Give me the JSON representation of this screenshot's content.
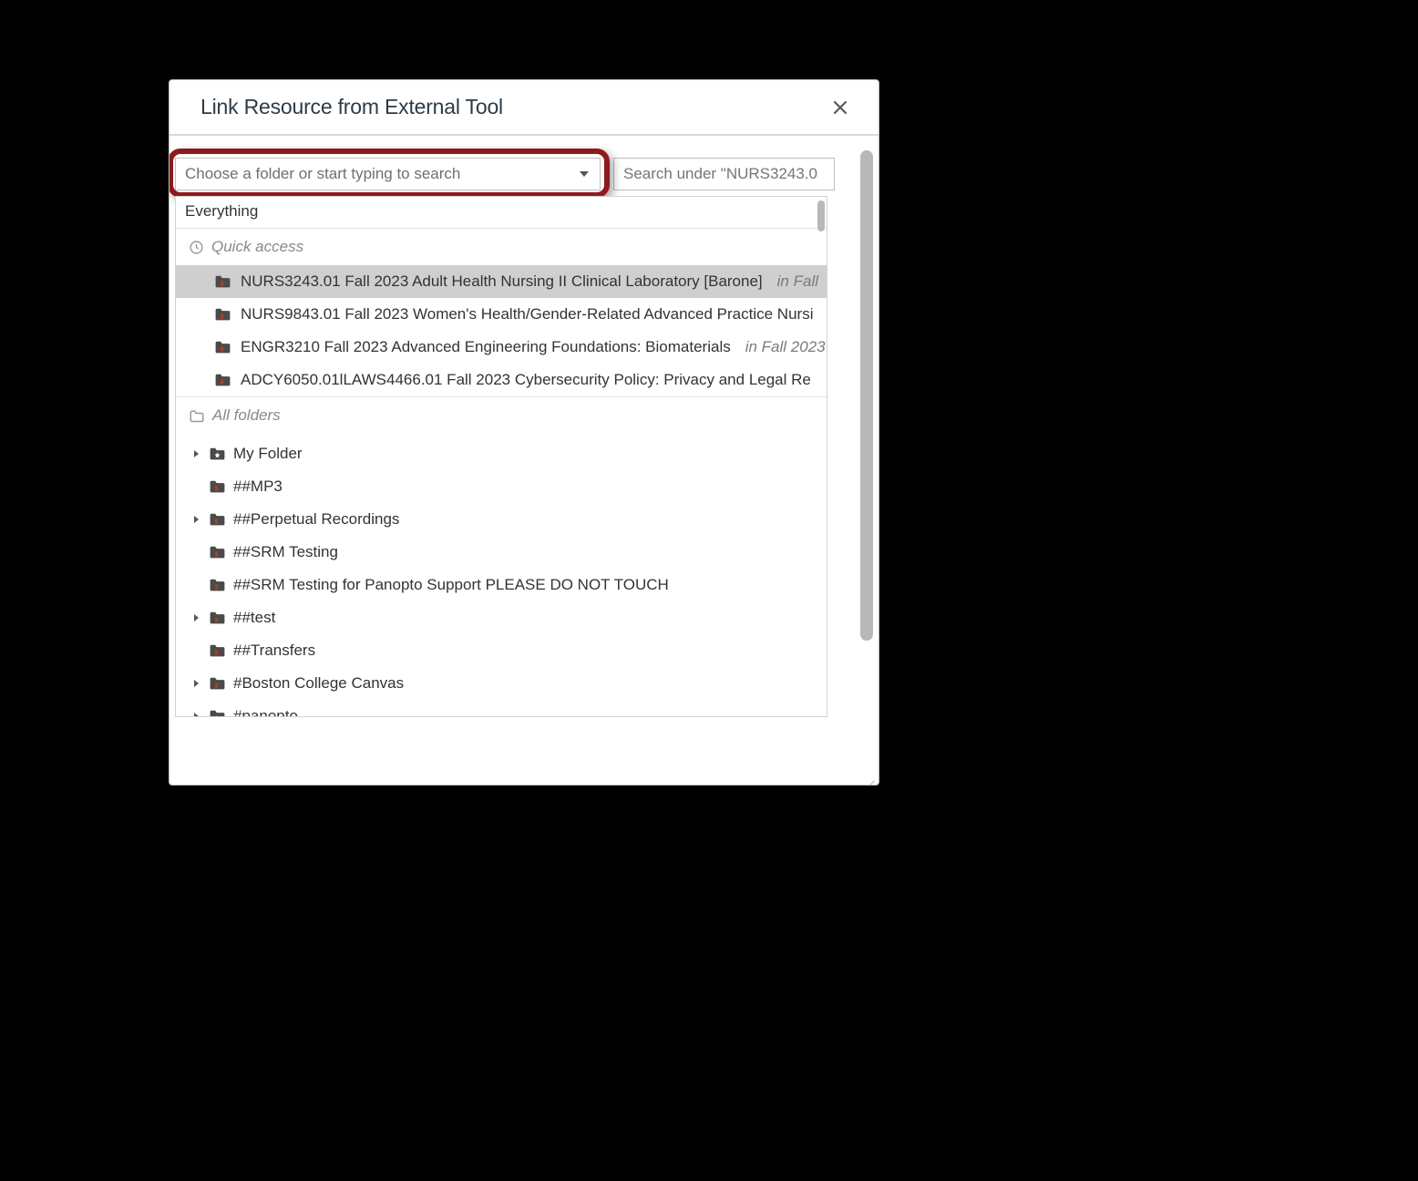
{
  "modal": {
    "title": "Link Resource from External Tool",
    "close_label": "Close"
  },
  "folder_select": {
    "placeholder": "Choose a folder or start typing to search"
  },
  "search": {
    "placeholder": "Search under \"NURS3243.0"
  },
  "dropdown": {
    "everything_label": "Everything",
    "quick_access_label": "Quick access",
    "quick_access_items": [
      {
        "label": "NURS3243.01 Fall 2023 Adult Health Nursing II Clinical Laboratory [Barone]",
        "suffix": "in Fall",
        "selected": true
      },
      {
        "label": "NURS9843.01 Fall 2023 Women's Health/Gender-Related Advanced Practice Nursi",
        "suffix": "",
        "selected": false
      },
      {
        "label": "ENGR3210 Fall 2023 Advanced Engineering Foundations: Biomaterials",
        "suffix": "in Fall 2023",
        "selected": false
      },
      {
        "label": "ADCY6050.01lLAWS4466.01 Fall 2023 Cybersecurity Policy: Privacy and Legal Re",
        "suffix": "",
        "selected": false
      }
    ],
    "all_folders_label": "All folders",
    "tree": [
      {
        "label": "My Folder",
        "expandable": true,
        "star": true
      },
      {
        "label": "##MP3",
        "expandable": false
      },
      {
        "label": "##Perpetual Recordings",
        "expandable": true
      },
      {
        "label": "##SRM Testing",
        "expandable": false
      },
      {
        "label": "##SRM Testing for Panopto Support PLEASE DO NOT TOUCH",
        "expandable": false
      },
      {
        "label": "##test",
        "expandable": true
      },
      {
        "label": "##Transfers",
        "expandable": false
      },
      {
        "label": "#Boston College Canvas",
        "expandable": true
      },
      {
        "label": "#panopto",
        "expandable": true
      }
    ]
  }
}
